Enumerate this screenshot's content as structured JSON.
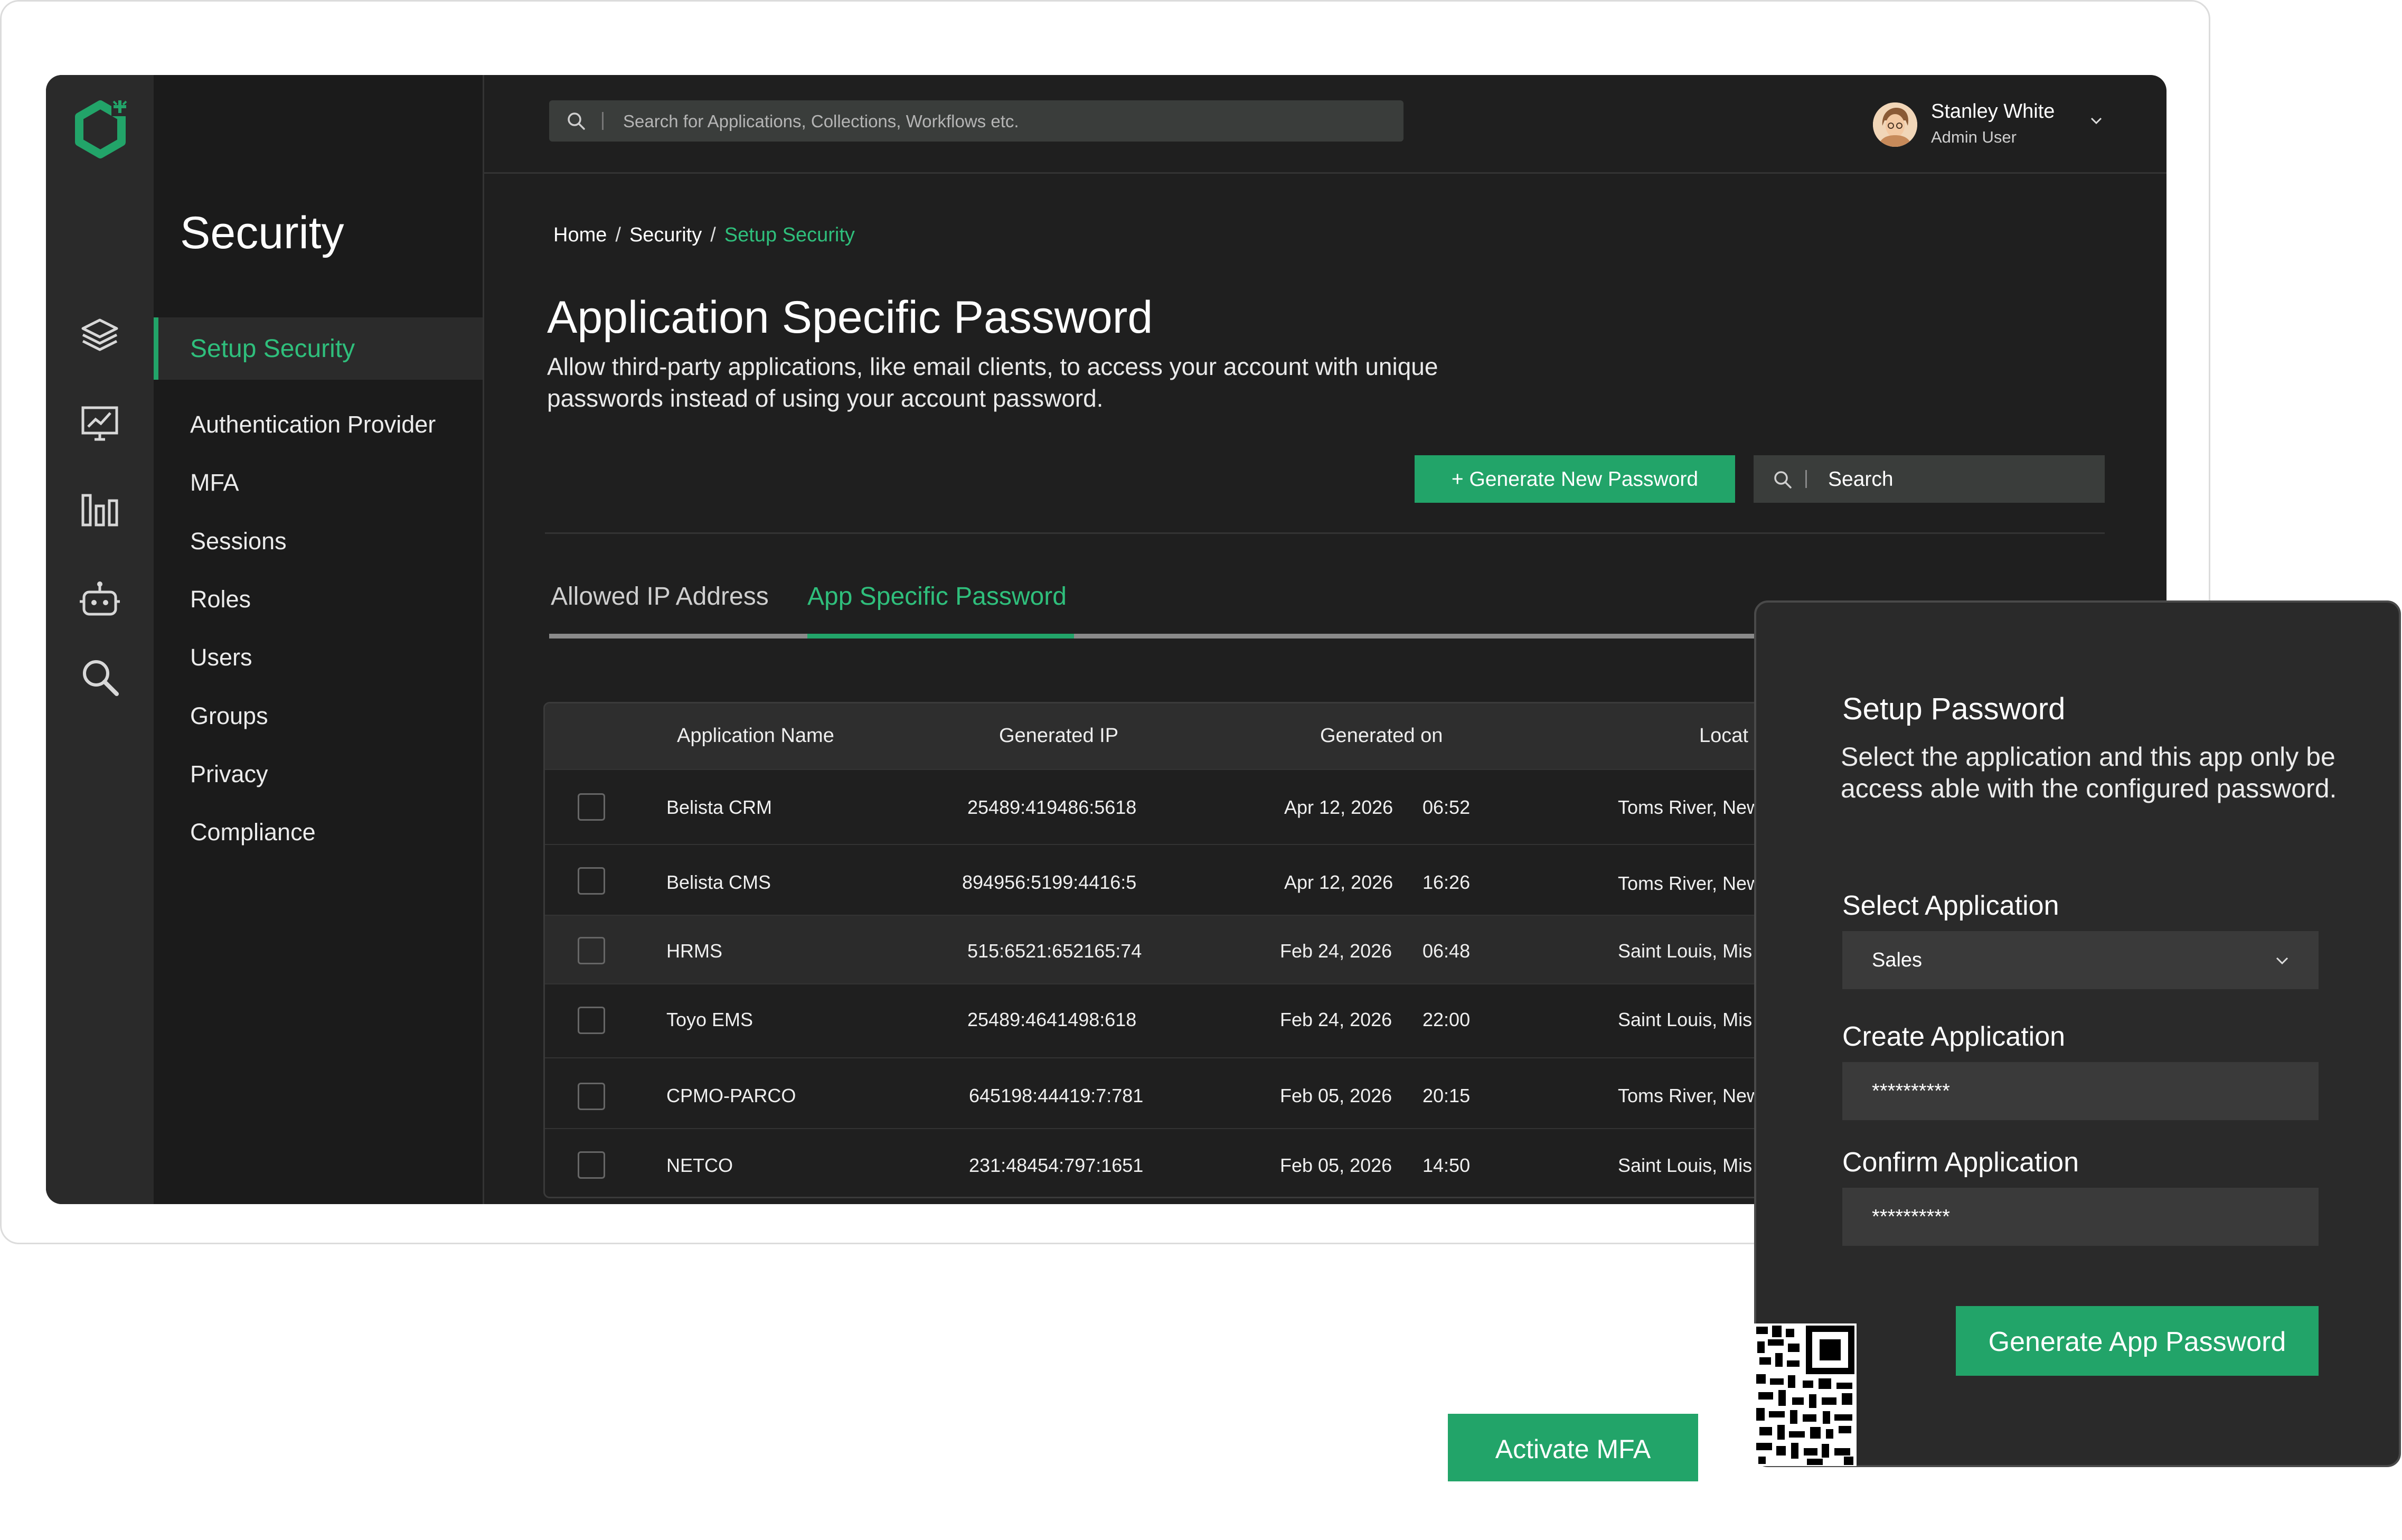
{
  "brand": {
    "accent": "#22a469",
    "accent_text": "#2fbf7c",
    "background": "#1f1f1f"
  },
  "rail": {
    "icons": [
      "logo-icon",
      "layers-icon",
      "analytics-icon",
      "bar-chart-icon",
      "robot-icon",
      "search-icon"
    ]
  },
  "sidebar": {
    "title": "Security",
    "active": "Setup Security",
    "items": [
      {
        "label": "Authentication Provider"
      },
      {
        "label": "MFA"
      },
      {
        "label": "Sessions"
      },
      {
        "label": "Roles"
      },
      {
        "label": "Users"
      },
      {
        "label": "Groups"
      },
      {
        "label": "Privacy"
      },
      {
        "label": "Compliance"
      }
    ]
  },
  "topbar": {
    "search_placeholder": "Search for Applications, Collections, Workflows etc.",
    "user_name": "Stanley White",
    "user_role": "Admin User"
  },
  "breadcrumb": {
    "home": "Home",
    "section": "Security",
    "current": "Setup Security",
    "separator": "/"
  },
  "page": {
    "title": "Application Specific Password",
    "description": "Allow third-party applications, like email clients, to access your account with unique passwords instead of using your account password.",
    "generate_button": "+  Generate New Password",
    "search_placeholder": "Search"
  },
  "tabs": [
    {
      "label": "Allowed IP Address",
      "active": false
    },
    {
      "label": "App Specific Password",
      "active": true
    }
  ],
  "table": {
    "columns": [
      "Application Name",
      "Generated IP",
      "Generated on",
      "Locat"
    ],
    "rows": [
      {
        "name": "Belista CRM",
        "ip": "25489:419486:5618",
        "date": "Apr 12,  2026",
        "time": "06:52",
        "location": "Toms River, New"
      },
      {
        "name": "Belista CMS",
        "ip": "894956:5199:4416:5",
        "date": "Apr 12,  2026",
        "time": "16:26",
        "location": "Toms River, New"
      },
      {
        "name": "HRMS",
        "ip": "515:6521:652165:74",
        "date": "Feb 24, 2026",
        "time": "06:48",
        "location": "Saint Louis, Mis"
      },
      {
        "name": "Toyo EMS",
        "ip": "25489:4641498:618",
        "date": "Feb 24, 2026",
        "time": "22:00",
        "location": "Saint Louis, Mis"
      },
      {
        "name": "CPMO-PARCO",
        "ip": "645198:44419:7:781",
        "date": "Feb 05, 2026",
        "time": "20:15",
        "location": "Toms River, New"
      },
      {
        "name": "NETCO",
        "ip": "231:48454:797:1651",
        "date": "Feb 05, 2026",
        "time": "14:50",
        "location": "Saint Louis, Mis"
      }
    ]
  },
  "modal": {
    "title": "Setup Password",
    "description": "Select the application and this app only be access able with the configured password.",
    "select_label": "Select Application",
    "select_value": "Sales",
    "create_label": "Create Application",
    "create_value": "**********",
    "confirm_label": "Confirm Application",
    "confirm_value": "**********",
    "button": "Generate App Password"
  },
  "activate_mfa": "Activate MFA"
}
